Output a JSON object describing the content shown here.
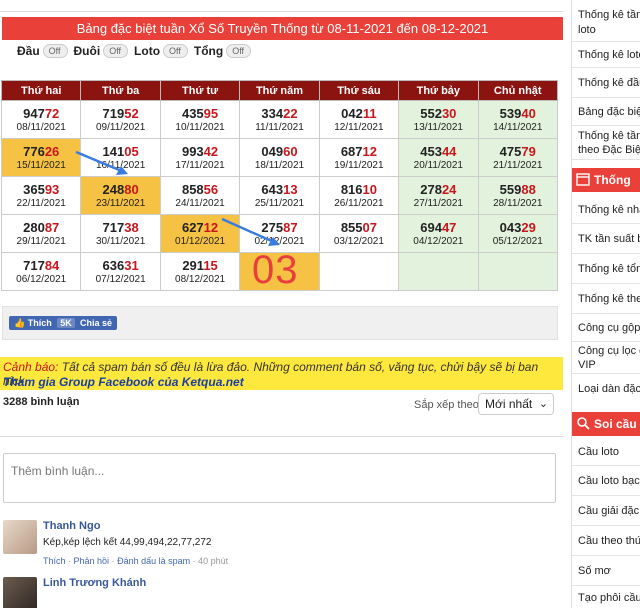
{
  "header": {
    "title": "Bảng đặc biệt tuần Xổ Số Truyền Thống từ 08-11-2021 đến 08-12-2021"
  },
  "toggles": [
    {
      "label": "Đầu",
      "state": "Off"
    },
    {
      "label": "Đuôi",
      "state": "Off"
    },
    {
      "label": "Loto",
      "state": "Off"
    },
    {
      "label": "Tổng",
      "state": "Off"
    }
  ],
  "table": {
    "columns": [
      "Thứ hai",
      "Thứ ba",
      "Thứ tư",
      "Thứ năm",
      "Thứ sáu",
      "Thứ bảy",
      "Chủ nhật"
    ],
    "rows": [
      [
        {
          "head": "947",
          "tail": "72",
          "date": "08/11/2021"
        },
        {
          "head": "719",
          "tail": "52",
          "date": "09/11/2021"
        },
        {
          "head": "435",
          "tail": "95",
          "date": "10/11/2021"
        },
        {
          "head": "334",
          "tail": "22",
          "date": "11/11/2021"
        },
        {
          "head": "042",
          "tail": "11",
          "date": "12/11/2021"
        },
        {
          "head": "552",
          "tail": "30",
          "date": "13/11/2021"
        },
        {
          "head": "539",
          "tail": "40",
          "date": "14/11/2021"
        }
      ],
      [
        {
          "head": "776",
          "tail": "26",
          "date": "15/11/2021",
          "hl": true
        },
        {
          "head": "141",
          "tail": "05",
          "date": "16/11/2021"
        },
        {
          "head": "993",
          "tail": "42",
          "date": "17/11/2021"
        },
        {
          "head": "049",
          "tail": "60",
          "date": "18/11/2021"
        },
        {
          "head": "687",
          "tail": "12",
          "date": "19/11/2021"
        },
        {
          "head": "453",
          "tail": "44",
          "date": "20/11/2021"
        },
        {
          "head": "475",
          "tail": "79",
          "date": "21/11/2021"
        }
      ],
      [
        {
          "head": "365",
          "tail": "93",
          "date": "22/11/2021"
        },
        {
          "head": "248",
          "tail": "80",
          "date": "23/11/2021",
          "hl": true
        },
        {
          "head": "858",
          "tail": "56",
          "date": "24/11/2021"
        },
        {
          "head": "643",
          "tail": "13",
          "date": "25/11/2021"
        },
        {
          "head": "816",
          "tail": "10",
          "date": "26/11/2021"
        },
        {
          "head": "278",
          "tail": "24",
          "date": "27/11/2021"
        },
        {
          "head": "559",
          "tail": "88",
          "date": "28/11/2021"
        }
      ],
      [
        {
          "head": "280",
          "tail": "87",
          "date": "29/11/2021"
        },
        {
          "head": "717",
          "tail": "38",
          "date": "30/11/2021"
        },
        {
          "head": "627",
          "tail": "12",
          "date": "01/12/2021",
          "hl": true
        },
        {
          "head": "275",
          "tail": "87",
          "date": "02/12/2021"
        },
        {
          "head": "855",
          "tail": "07",
          "date": "03/12/2021"
        },
        {
          "head": "694",
          "tail": "47",
          "date": "04/12/2021"
        },
        {
          "head": "043",
          "tail": "29",
          "date": "05/12/2021"
        }
      ],
      [
        {
          "head": "717",
          "tail": "84",
          "date": "06/12/2021"
        },
        {
          "head": "636",
          "tail": "31",
          "date": "07/12/2021"
        },
        {
          "head": "291",
          "tail": "15",
          "date": "08/12/2021"
        },
        {
          "head": "",
          "tail": "",
          "date": "",
          "hl": true
        },
        {
          "head": "",
          "tail": "",
          "date": ""
        },
        {
          "head": "",
          "tail": "",
          "date": ""
        },
        {
          "head": "",
          "tail": "",
          "date": ""
        }
      ]
    ],
    "annotation": "03"
  },
  "share": {
    "like_label": "Thích",
    "like_count": "5K",
    "share_label": "Chia sẻ"
  },
  "warning": {
    "label": "Cảnh báo:",
    "text": "Tất cả spam bán số đều là lừa đảo. Những comment bán số, văng tục, chửi bậy sẽ bị ban nick.",
    "link": "Tham gia Group Facebook của Ketqua.net"
  },
  "comments": {
    "count": "3288 bình luận",
    "sort_label": "Sắp xếp theo",
    "sort_value": "Mới nhất",
    "input_placeholder": "Thêm bình luận...",
    "items": [
      {
        "name": "Thanh Ngo",
        "text": "Kép,kép lệch kết 44,99,494,22,77,272",
        "like": "Thích",
        "reply": "Phản hồi",
        "spam": "Đánh dấu là spam",
        "time": "40 phút"
      },
      {
        "name": "Linh Trương Khánh"
      }
    ]
  },
  "sidebar": {
    "items_top": [
      "Thống kê tần",
      "loto",
      "Thống kê lotc",
      "Thống kê đầu",
      "Bảng đặc biệ",
      "Thống kê tần",
      "theo Đặc Biệt"
    ],
    "head1": "Thống",
    "items_mid": [
      "Thống kê nha",
      "TK tần suất b",
      "Thống kê tổn",
      "Thống kê theo",
      "Công cụ gộp",
      "Công cụ lọc g",
      "VIP",
      "Loại dàn đặc"
    ],
    "head2": "Soi cầu",
    "items_bottom": [
      "Cầu loto",
      "Cầu loto bạch",
      "Cầu giải đặc",
      "Cầu theo thứ",
      "Số mơ",
      "Tạo phôi cầu"
    ]
  }
}
